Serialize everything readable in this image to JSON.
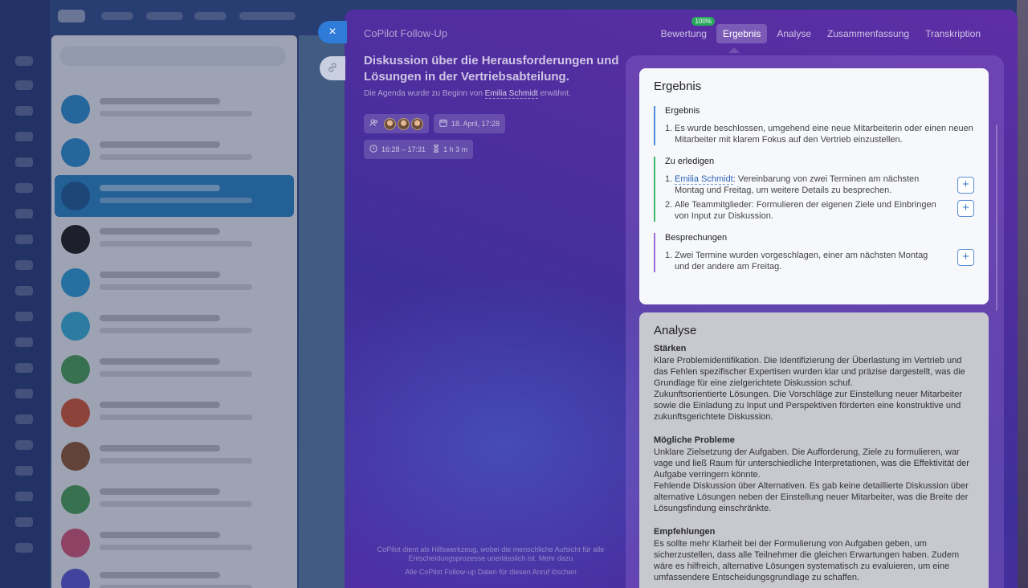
{
  "panel_title": "CoPilot Follow-Up",
  "tabs": [
    {
      "label": "Bewertung",
      "badge": "100%"
    },
    {
      "label": "Ergebnis"
    },
    {
      "label": "Analyse"
    },
    {
      "label": "Zusammenfassung"
    },
    {
      "label": "Transkription"
    }
  ],
  "meeting": {
    "title": "Diskussion über die Herausforderungen und Lösungen in der Vertriebsabteilung.",
    "agenda_prefix": "Die Agenda wurde zu Beginn von",
    "agenda_person": "Emilia Schmidt",
    "agenda_suffix": "erwähnt.",
    "date": "18. April, 17:28",
    "time_range": "16:28 – 17:31",
    "duration": "1 h 3 m"
  },
  "footer": {
    "note": "CoPilot dient als Hilfswerkzeug, wobei die menschliche Aufsicht für alle Entscheidungsprozesse unerlässlich ist.",
    "note_link": "Mehr dazu",
    "delete": "Alle CoPilot Follow-up Daten für diesen Anruf löschen"
  },
  "result": {
    "heading": "Ergebnis",
    "sections": [
      {
        "title": "Ergebnis",
        "color": "#4a90d9",
        "items": [
          "Es wurde beschlossen, umgehend eine neue Mitarbeiterin oder einen neuen Mitarbeiter mit klarem Fokus auf den Vertrieb einzustellen."
        ]
      },
      {
        "title": "Zu erledigen",
        "color": "#3dbb6b",
        "item1_person": "Emilia Schmidt",
        "item1_text": ": Vereinbarung von zwei Terminen am nächsten Montag und Freitag, um weitere Details zu besprechen.",
        "item2_text": "Alle Teammitglieder: Formulieren der eigenen Ziele und Einbringen von Input zur Diskussion."
      },
      {
        "title": "Besprechungen",
        "color": "#9b6fd6",
        "items": [
          "Zwei Termine wurden vorgeschlagen, einer am nächsten Montag und der andere am Freitag."
        ]
      }
    ]
  },
  "analysis": {
    "heading": "Analyse",
    "blocks": [
      {
        "title": "Stärken",
        "p1": "Klare Problemidentifikation. Die Identifizierung der Überlastung im Vertrieb und das Fehlen spezifischer Expertisen wurden klar und präzise dargestellt, was die Grundlage für eine zielgerichtete Diskussion schuf.",
        "p2": "Zukunftsorientierte Lösungen. Die Vorschläge zur Einstellung neuer Mitarbeiter sowie die Einladung zu Input und Perspektiven förderten eine konstruktive und zukunftsgerichtete Diskussion."
      },
      {
        "title": "Mögliche Probleme",
        "p1": "Unklare Zielsetzung der Aufgaben. Die Aufforderung, Ziele zu formulieren, war vage und ließ Raum für unterschiedliche Interpretationen, was die Effektivität der Aufgabe verringern könnte.",
        "p2": "Fehlende Diskussion über Alternativen. Es gab keine detaillierte Diskussion über alternative Lösungen neben der Einstellung neuer Mitarbeiter, was die Breite der Lösungsfindung einschränkte."
      },
      {
        "title": "Empfehlungen",
        "p1": "Es sollte mehr Klarheit bei der Formulierung von Aufgaben geben, um sicherzustellen, dass alle Teilnehmer die gleichen Erwartungen haben. Zudem wäre es hilfreich, alternative Lösungen systematisch zu evaluieren, um eine umfassendere Entscheidungsgrundlage zu schaffen."
      }
    ]
  },
  "icons": {
    "close": "×",
    "link": "🔗",
    "participants": "people-icon",
    "calendar": "calendar-icon",
    "clock": "clock-icon",
    "hourglass": "hourglass-icon",
    "plus": "+"
  }
}
